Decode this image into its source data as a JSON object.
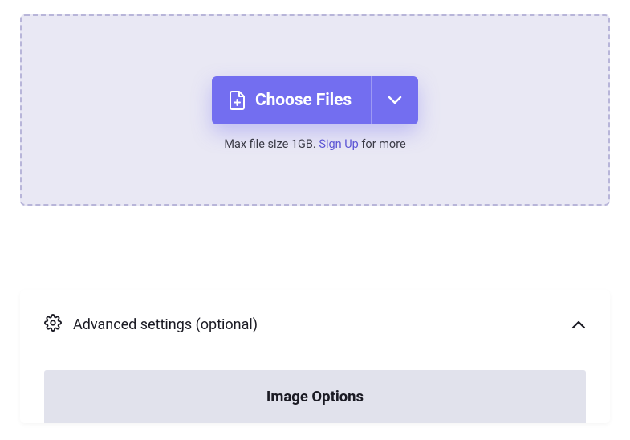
{
  "upload": {
    "choose_label": "Choose Files",
    "hint_prefix": "Max file size 1GB. ",
    "signup_label": "Sign Up",
    "hint_suffix": " for more"
  },
  "advanced": {
    "title": "Advanced settings (optional)",
    "section_label": "Image Options"
  }
}
